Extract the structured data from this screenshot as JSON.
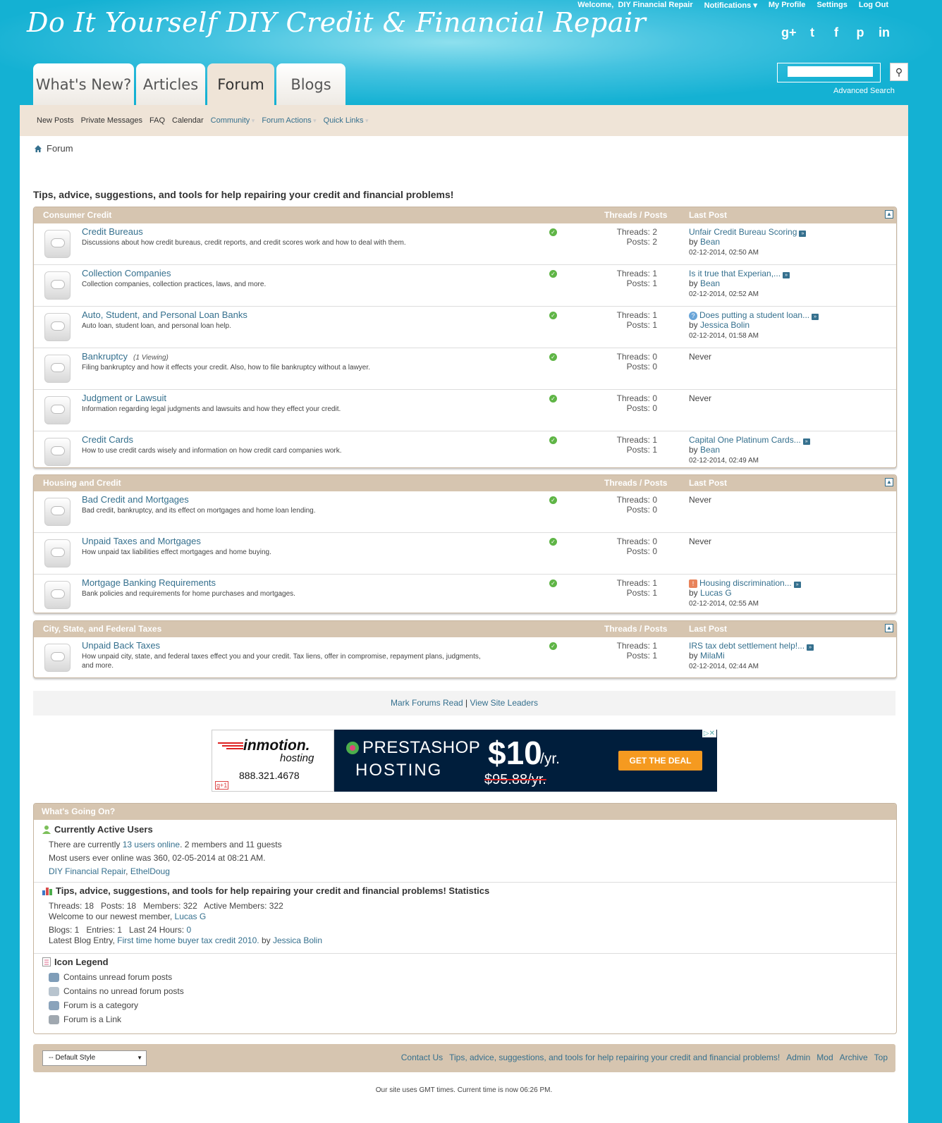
{
  "header": {
    "site_title": "Do It Yourself DIY Credit & Financial Repair",
    "welcome": "Welcome,",
    "username": "DIY Financial Repair",
    "notifications": "Notifications",
    "my_profile": "My Profile",
    "settings": "Settings",
    "log_out": "Log Out",
    "social": [
      "g+",
      "t",
      "f",
      "p",
      "in"
    ],
    "advanced_search": "Advanced Search",
    "search_placeholder": ""
  },
  "tabs": [
    {
      "label": "What's New?",
      "selected": false
    },
    {
      "label": "Articles",
      "selected": false
    },
    {
      "label": "Forum",
      "selected": true
    },
    {
      "label": "Blogs",
      "selected": false
    }
  ],
  "navbar": {
    "items": [
      "New Posts",
      "Private Messages",
      "FAQ",
      "Calendar"
    ],
    "dropdowns": [
      "Community",
      "Forum Actions",
      "Quick Links"
    ]
  },
  "breadcrumb": "Forum",
  "forum_title": "Tips, advice, suggestions, and tools for help repairing your credit and financial problems!",
  "col_threads_posts": "Threads / Posts",
  "col_last_post": "Last Post",
  "categories": [
    {
      "name": "Consumer Credit",
      "forums": [
        {
          "name": "Credit Bureaus",
          "viewing": "",
          "desc": "Discussions about how credit bureaus, credit reports, and credit scores work and how to deal with them.",
          "threads": "Threads: 2",
          "posts": "Posts: 2",
          "lp_title": "Unfair Credit Bureau Scoring",
          "lp_by": "by",
          "lp_user": "Bean",
          "lp_date": "02-12-2014, 02:50 AM",
          "lp_icon": ""
        },
        {
          "name": "Collection Companies",
          "viewing": "",
          "desc": "Collection companies, collection practices, laws, and more.",
          "threads": "Threads: 1",
          "posts": "Posts: 1",
          "lp_title": "Is it true that Experian,...",
          "lp_by": "by",
          "lp_user": "Bean",
          "lp_date": "02-12-2014, 02:52 AM",
          "lp_icon": ""
        },
        {
          "name": "Auto, Student, and Personal Loan Banks",
          "viewing": "",
          "desc": "Auto loan, student loan, and personal loan help.",
          "threads": "Threads: 1",
          "posts": "Posts: 1",
          "lp_title": "Does putting a student loan...",
          "lp_by": "by",
          "lp_user": "Jessica Bolin",
          "lp_date": "02-12-2014, 01:58 AM",
          "lp_icon": "question"
        },
        {
          "name": "Bankruptcy",
          "viewing": "(1 Viewing)",
          "desc": "Filing bankruptcy and how it effects your credit. Also, how to file bankruptcy without a lawyer.",
          "threads": "Threads: 0",
          "posts": "Posts: 0",
          "lp_never": "Never"
        },
        {
          "name": "Judgment or Lawsuit",
          "viewing": "",
          "desc": "Information regarding legal judgments and lawsuits and how they effect your credit.",
          "threads": "Threads: 0",
          "posts": "Posts: 0",
          "lp_never": "Never"
        },
        {
          "name": "Credit Cards",
          "viewing": "",
          "desc": "How to use credit cards wisely and information on how credit card companies work.",
          "threads": "Threads: 1",
          "posts": "Posts: 1",
          "lp_title": "Capital One Platinum Cards...",
          "lp_by": "by",
          "lp_user": "Bean",
          "lp_date": "02-12-2014, 02:49 AM",
          "lp_icon": ""
        }
      ]
    },
    {
      "name": "Housing and Credit",
      "forums": [
        {
          "name": "Bad Credit and Mortgages",
          "viewing": "",
          "desc": "Bad credit, bankruptcy, and its effect on mortgages and home loan lending.",
          "threads": "Threads: 0",
          "posts": "Posts: 0",
          "lp_never": "Never"
        },
        {
          "name": "Unpaid Taxes and Mortgages",
          "viewing": "",
          "desc": "How unpaid tax liabilities effect mortgages and home buying.",
          "threads": "Threads: 0",
          "posts": "Posts: 0",
          "lp_never": "Never"
        },
        {
          "name": "Mortgage Banking Requirements",
          "viewing": "",
          "desc": "Bank policies and requirements for home purchases and mortgages.",
          "threads": "Threads: 1",
          "posts": "Posts: 1",
          "lp_title": "Housing discrimination...",
          "lp_by": "by",
          "lp_user": "Lucas G",
          "lp_date": "02-12-2014, 02:55 AM",
          "lp_icon": "flag"
        }
      ]
    },
    {
      "name": "City, State, and Federal Taxes",
      "forums": [
        {
          "name": "Unpaid Back Taxes",
          "viewing": "",
          "desc": "How unpaid city, state, and federal taxes effect you and your credit. Tax liens, offer in compromise, repayment plans, judgments, and more.",
          "threads": "Threads: 1",
          "posts": "Posts: 1",
          "lp_title": "IRS tax debt settlement help!...",
          "lp_by": "by",
          "lp_user": "MilaMi",
          "lp_date": "02-12-2014, 02:44 AM",
          "lp_icon": ""
        }
      ]
    }
  ],
  "markbar": {
    "mark_read": "Mark Forums Read",
    "sep": "|",
    "site_leaders": "View Site Leaders"
  },
  "ad": {
    "brand": "inmotion.",
    "hosting": "hosting",
    "phone": "888.321.4678",
    "gplus": "g+1",
    "presta": "PRESTASHOP",
    "presta_hosting": "HOSTING",
    "price": "$10",
    "per_year": "/yr.",
    "old_price": "$95.88/yr.",
    "cta": "GET THE DEAL",
    "close": "▷✕"
  },
  "wgo": {
    "title": "What's Going On?",
    "active_title": "Currently Active Users",
    "there_are": "There are currently",
    "users_online": "13 users online",
    "members_guests": ". 2 members and 11 guests",
    "most_ever": "Most users ever online was 360, 02-05-2014 at 08:21 AM.",
    "online_users": [
      "DIY Financial Repair",
      "EthelDoug"
    ],
    "stats_title": "Tips, advice, suggestions, and tools for help repairing your credit and financial problems! Statistics",
    "stats_line": "Threads: 18   Posts: 18   Members: 322   Active Members: 322",
    "newest_prefix": "Welcome to our newest member,",
    "newest_member": "Lucas G",
    "blogs_line": "Blogs: 1   Entries: 1   Last 24 Hours:",
    "blogs_last24": "0",
    "latest_blog_prefix": "Latest Blog Entry,",
    "latest_blog": "First time home buyer tax credit 2010.",
    "latest_blog_by": "by",
    "latest_blog_user": "Jessica Bolin",
    "legend_title": "Icon Legend",
    "legend": [
      "Contains unread forum posts",
      "Contains no unread forum posts",
      "Forum is a category",
      "Forum is a Link"
    ]
  },
  "footer": {
    "style_select": "-- Default Style",
    "links": [
      "Contact Us",
      "Tips, advice, suggestions, and tools for help repairing your credit and financial problems!",
      "Admin",
      "Mod",
      "Archive",
      "Top"
    ],
    "time_prefix": "Our site uses GMT times. Current time is now",
    "time": "06:26 PM."
  }
}
